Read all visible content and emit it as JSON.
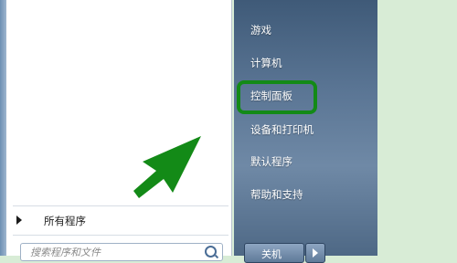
{
  "left_pane": {
    "all_programs": "所有程序",
    "search_placeholder": "搜索程序和文件"
  },
  "right_pane": {
    "items": [
      "游戏",
      "计算机",
      "控制面板",
      "设备和打印机",
      "默认程序",
      "帮助和支持"
    ]
  },
  "shutdown": {
    "label": "关机"
  },
  "annotation": {
    "highlight_color": "#138a17",
    "arrow_color": "#138a17"
  }
}
